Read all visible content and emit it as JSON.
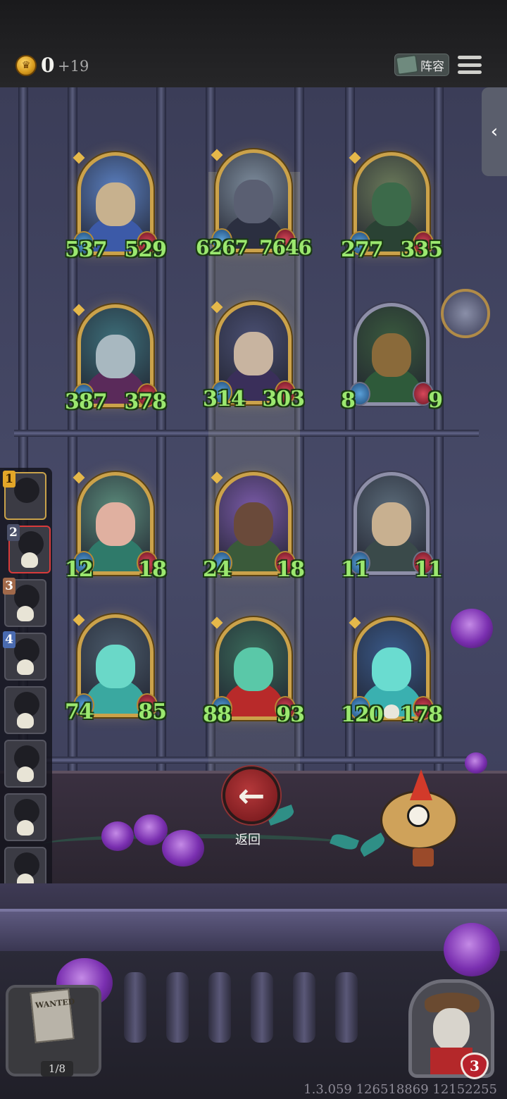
{
  "header": {
    "coins": "0",
    "coin_bonus": "+19",
    "lineup_label": "阵容"
  },
  "board": {
    "cards": [
      {
        "id": "king",
        "attack": "537",
        "health": "529",
        "skull": false,
        "golden": true,
        "face": "#c7b18e",
        "body": "#3c5aa8",
        "bg": "#5a7fc0"
      },
      {
        "id": "mushroom-spider",
        "attack": "6267",
        "health": "7646",
        "skull": false,
        "golden": true,
        "face": "#5a5f72",
        "body": "#2b2f40",
        "bg": "#7d8c9c"
      },
      {
        "id": "goblin-beast",
        "attack": "277",
        "health": "335",
        "skull": false,
        "golden": true,
        "face": "#3c6a4a",
        "body": "#2a4234",
        "bg": "#6b7a5a"
      },
      {
        "id": "elf-sorceress",
        "attack": "387",
        "health": "378",
        "skull": false,
        "golden": true,
        "face": "#a8b8c0",
        "body": "#5a2a5a",
        "bg": "#3d6f7a"
      },
      {
        "id": "blue-hair-witch",
        "attack": "314",
        "health": "303",
        "skull": false,
        "golden": true,
        "face": "#c8b4a0",
        "body": "#3a2f5a",
        "bg": "#4a4f72"
      },
      {
        "id": "masked-druid",
        "attack": "8",
        "health": "9",
        "skull": false,
        "golden": false,
        "face": "#8a6a3a",
        "body": "#2e5a3a",
        "bg": "#3a5a3e"
      },
      {
        "id": "red-hair-priestess",
        "attack": "12",
        "health": "18",
        "skull": false,
        "golden": true,
        "face": "#e0b0a0",
        "body": "#2f7a6a",
        "bg": "#5a8a7a"
      },
      {
        "id": "green-mystic",
        "attack": "24",
        "health": "18",
        "skull": false,
        "golden": true,
        "face": "#6a4a3a",
        "body": "#3a5a3a",
        "bg": "#7a5aa8"
      },
      {
        "id": "pipe-hunter",
        "attack": "11",
        "health": "11",
        "skull": false,
        "golden": false,
        "face": "#c8b090",
        "body": "#3a4a4a",
        "bg": "#5a6a78"
      },
      {
        "id": "ghost-brute",
        "attack": "74",
        "health": "85",
        "skull": false,
        "golden": true,
        "face": "#6ad8c8",
        "body": "#3aa8a0",
        "bg": "#4a5a6a"
      },
      {
        "id": "ghost-ogre",
        "attack": "88",
        "health": "93",
        "skull": false,
        "golden": true,
        "face": "#5ac8a8",
        "body": "#b82a2a",
        "bg": "#3a6a5a"
      },
      {
        "id": "ghost-maiden",
        "attack": "120",
        "health": "178",
        "skull": true,
        "golden": true,
        "face": "#6adcd0",
        "body": "#3ab0b0",
        "bg": "#3a5a8a"
      }
    ]
  },
  "roster": [
    {
      "number": "1",
      "skull": false,
      "tier": "gold"
    },
    {
      "number": "2",
      "skull": true,
      "tier": "silver",
      "active": true
    },
    {
      "number": "3",
      "skull": true,
      "tier": "bronze"
    },
    {
      "number": "4",
      "skull": true,
      "tier": "blue"
    },
    {
      "number": "",
      "skull": true
    },
    {
      "number": "",
      "skull": true
    },
    {
      "number": "",
      "skull": true
    },
    {
      "number": "",
      "skull": true
    }
  ],
  "controls": {
    "back_label": "返回",
    "back_icon": "←",
    "side_tab_icon": "‹"
  },
  "wanted": {
    "poster_title": "WANTED",
    "progress": "1/8"
  },
  "hero": {
    "lives": "3"
  },
  "footer": {
    "version": "1.3.059 126518869 12152255"
  },
  "colors": {
    "stat_green": "#9be86f",
    "gold_frame": "#cba24a",
    "accent_red": "#b4383a"
  }
}
